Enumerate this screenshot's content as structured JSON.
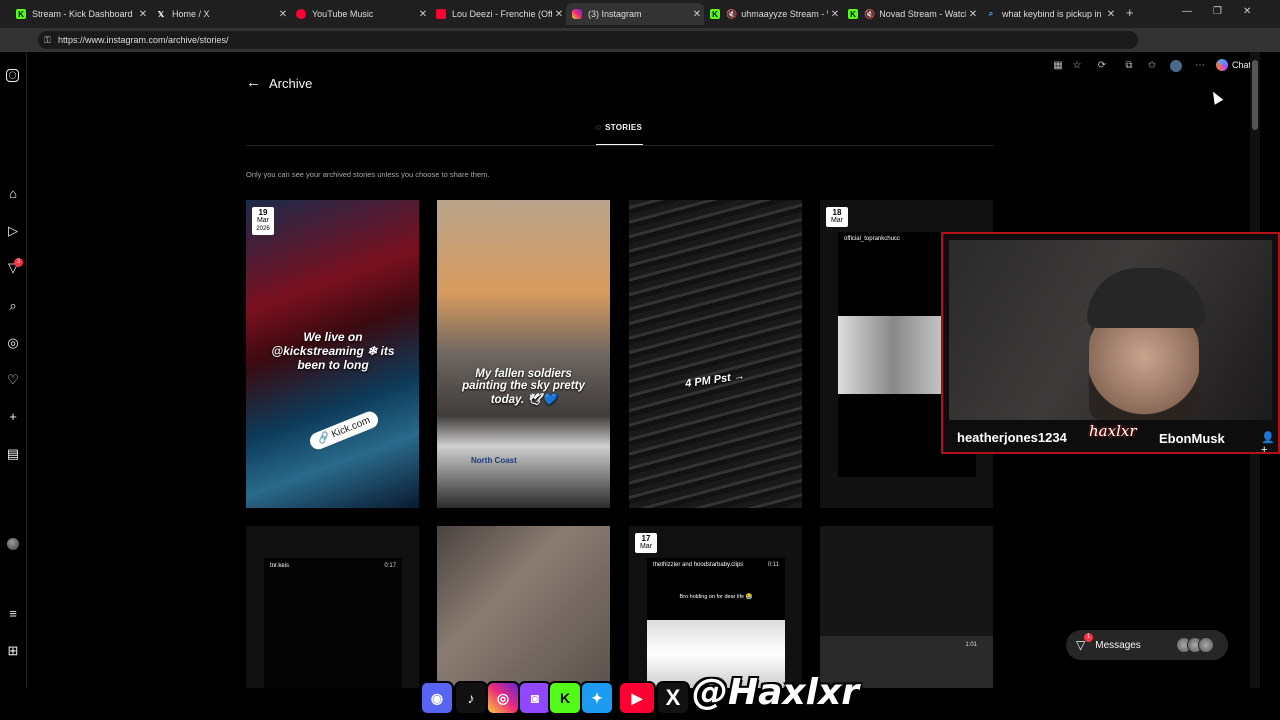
{
  "browser": {
    "tabs": [
      {
        "title": "Stream - Kick Dashboard",
        "icon": "kick-icon",
        "color": "#53fc18"
      },
      {
        "title": "Home / X",
        "icon": "x-icon",
        "color": "#ffffff"
      },
      {
        "title": "YouTube Music",
        "icon": "youtube-music-icon",
        "color": "#ff0033"
      },
      {
        "title": "Lou Deezi - Frenchie (Officia",
        "icon": "youtube-icon",
        "color": "#ff0033"
      },
      {
        "title": "(3) Instagram",
        "icon": "instagram-icon",
        "color": "#e1306c"
      },
      {
        "title": "uhmaayyze Stream - W",
        "icon": "kick-icon",
        "color": "#53fc18"
      },
      {
        "title": "Novad Stream - Watch",
        "icon": "kick-icon",
        "color": "#53fc18"
      },
      {
        "title": "what keybind is pickup in ru",
        "icon": "search-icon",
        "color": "#4aa3ff"
      }
    ],
    "url": "https://www.instagram.com/archive/stories/",
    "chat_label": "Chat"
  },
  "instagram": {
    "page_title": "Archive",
    "stories_tab": "STORIES",
    "note": "Only you can see your archived stories unless you choose to share them.",
    "notification_count": "3",
    "cards": [
      {
        "date_day": "19",
        "date_month": "Mar",
        "date_year": "2026",
        "caption": "We live on @kickstreaming ❄ its been to long",
        "sticker": "Kick.com"
      },
      {
        "caption": "My fallen soldiers painting the sky pretty today. 🕊💙"
      },
      {
        "caption": "4 PM Pst →"
      },
      {
        "date_day": "18",
        "date_month": "Mar",
        "username": "official_toprankchucc"
      },
      {
        "username": "tnr.keis",
        "time": "0:17"
      },
      {},
      {
        "date_day": "17",
        "date_month": "Mar",
        "username": "thethizzler and hoodstarbaby.clips",
        "time": "0:11",
        "caption": "Bro holding on for dear life 😭"
      },
      {
        "time": "1:01"
      }
    ],
    "messages_label": "Messages",
    "messages_count": "1"
  },
  "stream_overlay": {
    "webcam_name": "heatherjones1234",
    "webcam_tag": "haxlxr",
    "webcam_handle": "EbonMusk",
    "social_handle": "@Haxlxr",
    "socials": [
      "discord-icon",
      "tiktok-icon",
      "instagram-icon",
      "twitch-icon",
      "kick-icon",
      "twitter-icon",
      "youtube-icon",
      "x-icon"
    ]
  }
}
